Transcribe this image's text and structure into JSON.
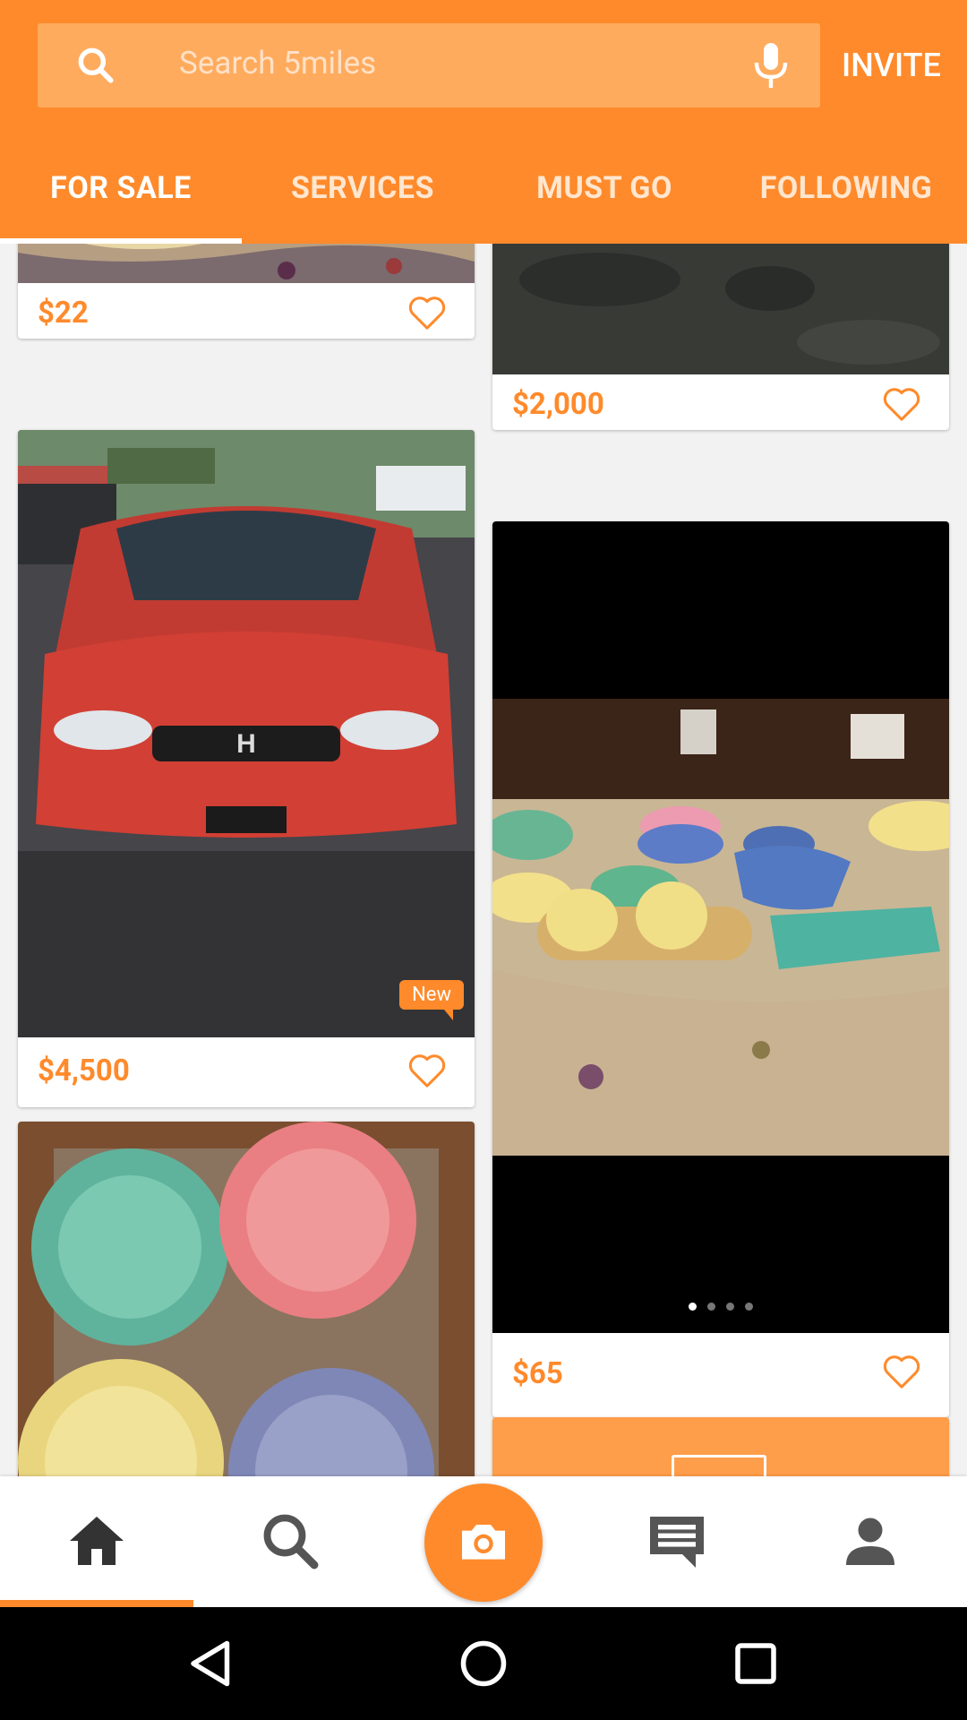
{
  "header": {
    "search_placeholder": "Search 5miles",
    "invite_label": "INVITE",
    "accent_color": "#ff8a2b"
  },
  "tabs": [
    {
      "label": "FOR SALE",
      "active": true
    },
    {
      "label": "SERVICES",
      "active": false
    },
    {
      "label": "MUST GO",
      "active": false
    },
    {
      "label": "FOLLOWING",
      "active": false
    }
  ],
  "listings": {
    "left": [
      {
        "price": "$22",
        "image": "porcelain-plates-tablecloth"
      },
      {
        "price": "$4,500",
        "image": "red-honda-civic",
        "badge": "New"
      },
      {
        "image": "colorful-bowls"
      }
    ],
    "right": [
      {
        "price": "$2,000",
        "image": "dark-textured-surface"
      },
      {
        "price": "$65",
        "image": "fiesta-dishware-table",
        "carousel_pages": 4,
        "carousel_active": 1
      },
      {
        "image": "orange-promo-tile"
      }
    ]
  },
  "bottom_nav": [
    {
      "icon": "home-icon",
      "active": true
    },
    {
      "icon": "search-icon",
      "active": false
    },
    {
      "icon": "camera-icon",
      "active": false
    },
    {
      "icon": "chat-icon",
      "active": false
    },
    {
      "icon": "profile-icon",
      "active": false
    }
  ],
  "system_nav": [
    "back-icon",
    "home-circle-icon",
    "recents-icon"
  ]
}
